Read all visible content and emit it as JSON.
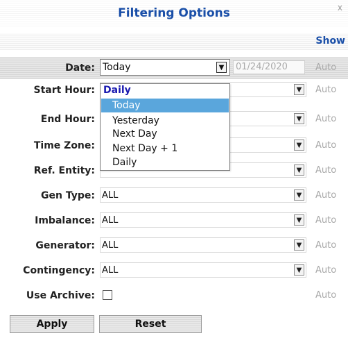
{
  "dialog": {
    "title": "Filtering Options",
    "close_label": "x",
    "show_label": "Show"
  },
  "date": {
    "label": "Date:",
    "selected": "Today",
    "date_value": "01/24/2020",
    "auto": "Auto",
    "dropdown": {
      "group_label": "Daily",
      "options": [
        "Today",
        "Yesterday",
        "Next Day",
        "Next Day + 1",
        "Daily"
      ],
      "selected_option": "Today"
    }
  },
  "rows": [
    {
      "label": "Start Hour:",
      "value": "",
      "auto": "Auto"
    },
    {
      "label": "End Hour:",
      "value": "",
      "auto": "Auto"
    },
    {
      "label": "Time Zone:",
      "value": "",
      "auto": "Auto"
    },
    {
      "label": "Ref. Entity:",
      "value": "",
      "auto": "Auto"
    },
    {
      "label": "Gen Type:",
      "value": "ALL",
      "auto": "Auto"
    },
    {
      "label": "Imbalance:",
      "value": "ALL",
      "auto": "Auto"
    },
    {
      "label": "Generator:",
      "value": "ALL",
      "auto": "Auto"
    },
    {
      "label": "Contingency:",
      "value": "ALL",
      "auto": "Auto"
    }
  ],
  "archive": {
    "label": "Use Archive:",
    "checked": false,
    "auto": "Auto"
  },
  "buttons": {
    "apply": "Apply",
    "reset": "Reset"
  },
  "colors": {
    "accent": "#1a4fa8",
    "selection": "#5aa6dc",
    "group": "#1a1ab0"
  }
}
